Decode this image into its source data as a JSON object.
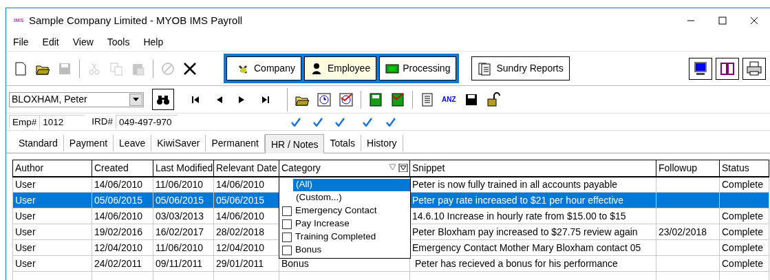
{
  "window": {
    "app_badge": "IMS",
    "title": "Sample Company Limited - MYOB IMS Payroll"
  },
  "menu": [
    "File",
    "Edit",
    "View",
    "Tools",
    "Help"
  ],
  "toolbar": [
    {
      "kind": "new",
      "disabled": false
    },
    {
      "kind": "open",
      "disabled": false
    },
    {
      "kind": "save",
      "disabled": true
    },
    {
      "kind": "sep"
    },
    {
      "kind": "cut",
      "disabled": true
    },
    {
      "kind": "copy",
      "disabled": true
    },
    {
      "kind": "paste",
      "disabled": true
    },
    {
      "kind": "sep"
    },
    {
      "kind": "cancel",
      "disabled": true
    },
    {
      "kind": "delete",
      "disabled": false
    }
  ],
  "modules": [
    {
      "kind": "company",
      "label": "Company",
      "selected": false
    },
    {
      "kind": "employee",
      "label": "Employee",
      "selected": true
    },
    {
      "kind": "processing",
      "label": "Processing",
      "selected": false
    }
  ],
  "sundry_button": {
    "label": "Sundry Reports"
  },
  "employee_select": {
    "value": "BLOXHAM, Peter"
  },
  "employee_info": {
    "emp_label": "Emp#",
    "emp_no": "1012",
    "ird_label": "IRD#",
    "ird_no": "049-497-970"
  },
  "record_tools": [
    {
      "kind": "folder",
      "checked": true
    },
    {
      "kind": "clock",
      "checked": true
    },
    {
      "kind": "clock-x",
      "checked": true
    },
    {
      "kind": "sep"
    },
    {
      "kind": "calc",
      "checked": true
    },
    {
      "kind": "calc-x",
      "checked": true
    },
    {
      "kind": "sep"
    },
    {
      "kind": "doc"
    },
    {
      "kind": "anz",
      "label": "ANZ"
    },
    {
      "kind": "save"
    },
    {
      "kind": "unlock"
    }
  ],
  "tabs": [
    {
      "label": "Standard",
      "selected": false
    },
    {
      "label": "Payment",
      "selected": false
    },
    {
      "label": "Leave",
      "selected": false
    },
    {
      "label": "KiwiSaver",
      "selected": false
    },
    {
      "label": "Permanent",
      "selected": false
    },
    {
      "label": "HR / Notes",
      "selected": true
    },
    {
      "label": "Totals",
      "selected": false
    },
    {
      "label": "History",
      "selected": false
    }
  ],
  "table": {
    "columns": [
      "Author",
      "Created",
      "Last Modified",
      "Relevant Date",
      "Category",
      "Snippet",
      "Followup",
      "Status"
    ],
    "rows": [
      {
        "selected": false,
        "cells": [
          "User",
          "14/06/2010",
          "11/06/2010",
          "14/06/2010",
          "",
          "Peter is now fully trained in all accounts payable",
          "",
          "Complete"
        ]
      },
      {
        "selected": true,
        "cells": [
          "User",
          "05/06/2015",
          "05/06/2015",
          "05/06/2015",
          "",
          "Peter pay rate increased to $21 per hour effective",
          "",
          ""
        ]
      },
      {
        "selected": false,
        "cells": [
          "User",
          "14/06/2010",
          "03/03/2013",
          "14/06/2010",
          "",
          "14.6.10 Increase in hourly rate from $15.00 to $15",
          "",
          "Complete"
        ]
      },
      {
        "selected": false,
        "cells": [
          "User",
          "19/02/2016",
          "16/02/2017",
          "28/02/2018",
          "",
          "Peter Bloxham pay increased to $27.75 review again",
          "23/02/2018",
          "Complete"
        ]
      },
      {
        "selected": false,
        "cells": [
          "User",
          "12/04/2010",
          "11/06/2010",
          "12/04/2010",
          "",
          "Emergency Contact Mother Mary Bloxham contact 05",
          "",
          "Complete"
        ]
      },
      {
        "selected": false,
        "cells": [
          "User",
          "24/02/2011",
          "09/11/2011",
          "29/01/2011",
          "Bonus",
          " Peter has recieved a bonus for his performance",
          "",
          "Complete"
        ]
      }
    ]
  },
  "filter_dropdown": {
    "items": [
      {
        "kind": "option",
        "label": "(All)",
        "selected": true
      },
      {
        "kind": "option",
        "label": "(Custom...)",
        "selected": false
      },
      {
        "kind": "checkbox",
        "label": "Emergency Contact",
        "checked": false
      },
      {
        "kind": "checkbox",
        "label": "Pay Increase",
        "checked": false
      },
      {
        "kind": "checkbox",
        "label": "Training Completed",
        "checked": false
      },
      {
        "kind": "checkbox",
        "label": "Bonus",
        "checked": false
      }
    ]
  }
}
